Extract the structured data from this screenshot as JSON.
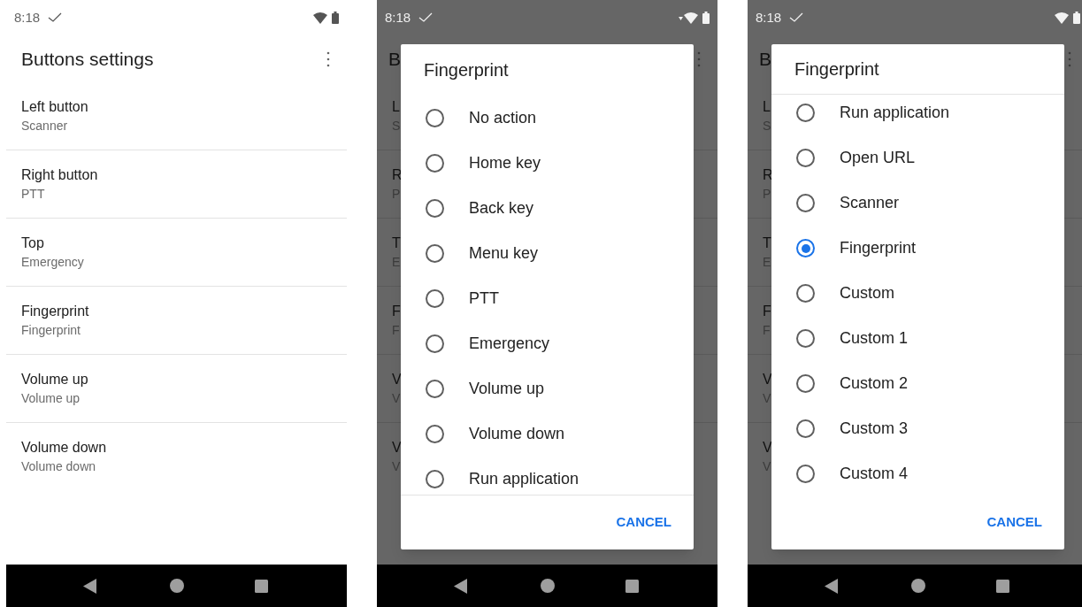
{
  "screens": [
    {
      "kind": "settings",
      "status": {
        "time": "8:18",
        "activity": false
      },
      "title": "Buttons settings",
      "items": [
        {
          "title": "Left button",
          "summary": "Scanner"
        },
        {
          "title": "Right button",
          "summary": "PTT"
        },
        {
          "title": "Top",
          "summary": "Emergency"
        },
        {
          "title": "Fingerprint",
          "summary": "Fingerprint"
        },
        {
          "title": "Volume up",
          "summary": "Volume up"
        },
        {
          "title": "Volume down",
          "summary": "Volume down"
        }
      ]
    },
    {
      "kind": "dialog",
      "status": {
        "time": "8:18",
        "activity": true
      },
      "background": {
        "title": "B",
        "items": [
          {
            "title": "L",
            "summary": "S"
          },
          {
            "title": "R",
            "summary": "P"
          },
          {
            "title": "T",
            "summary": "E"
          },
          {
            "title": "F",
            "summary": "F"
          },
          {
            "title": "V",
            "summary": "V"
          },
          {
            "title": "V",
            "summary": "V"
          }
        ]
      },
      "dialog": {
        "title": "Fingerprint",
        "scrolled": false,
        "options": [
          {
            "label": "No action",
            "selected": false
          },
          {
            "label": "Home key",
            "selected": false
          },
          {
            "label": "Back key",
            "selected": false
          },
          {
            "label": "Menu key",
            "selected": false
          },
          {
            "label": "PTT",
            "selected": false
          },
          {
            "label": "Emergency",
            "selected": false
          },
          {
            "label": "Volume up",
            "selected": false
          },
          {
            "label": "Volume down",
            "selected": false
          },
          {
            "label": "Run application",
            "selected": false
          }
        ],
        "button": "CANCEL"
      }
    },
    {
      "kind": "dialog",
      "status": {
        "time": "8:18",
        "activity": false
      },
      "background": {
        "title": "B",
        "items": [
          {
            "title": "L",
            "summary": "S"
          },
          {
            "title": "R",
            "summary": "P"
          },
          {
            "title": "T",
            "summary": "E"
          },
          {
            "title": "F",
            "summary": "F"
          },
          {
            "title": "V",
            "summary": "V"
          },
          {
            "title": "V",
            "summary": "V"
          }
        ]
      },
      "dialog": {
        "title": "Fingerprint",
        "scrolled": true,
        "options": [
          {
            "label": "Run application",
            "selected": false
          },
          {
            "label": "Open URL",
            "selected": false
          },
          {
            "label": "Scanner",
            "selected": false
          },
          {
            "label": "Fingerprint",
            "selected": true
          },
          {
            "label": "Custom",
            "selected": false
          },
          {
            "label": "Custom 1",
            "selected": false
          },
          {
            "label": "Custom 2",
            "selected": false
          },
          {
            "label": "Custom 3",
            "selected": false
          },
          {
            "label": "Custom 4",
            "selected": false
          }
        ],
        "button": "CANCEL"
      }
    }
  ]
}
